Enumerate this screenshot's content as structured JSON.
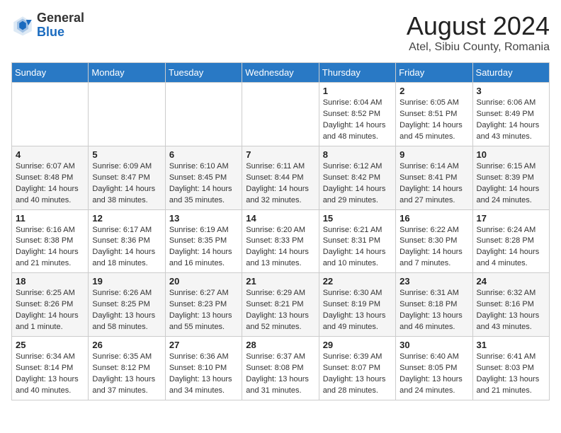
{
  "header": {
    "logo_line1": "General",
    "logo_line2": "Blue",
    "title": "August 2024",
    "subtitle": "Atel, Sibiu County, Romania"
  },
  "weekdays": [
    "Sunday",
    "Monday",
    "Tuesday",
    "Wednesday",
    "Thursday",
    "Friday",
    "Saturday"
  ],
  "weeks": [
    [
      {
        "day": "",
        "info": ""
      },
      {
        "day": "",
        "info": ""
      },
      {
        "day": "",
        "info": ""
      },
      {
        "day": "",
        "info": ""
      },
      {
        "day": "1",
        "info": "Sunrise: 6:04 AM\nSunset: 8:52 PM\nDaylight: 14 hours and 48 minutes."
      },
      {
        "day": "2",
        "info": "Sunrise: 6:05 AM\nSunset: 8:51 PM\nDaylight: 14 hours and 45 minutes."
      },
      {
        "day": "3",
        "info": "Sunrise: 6:06 AM\nSunset: 8:49 PM\nDaylight: 14 hours and 43 minutes."
      }
    ],
    [
      {
        "day": "4",
        "info": "Sunrise: 6:07 AM\nSunset: 8:48 PM\nDaylight: 14 hours and 40 minutes."
      },
      {
        "day": "5",
        "info": "Sunrise: 6:09 AM\nSunset: 8:47 PM\nDaylight: 14 hours and 38 minutes."
      },
      {
        "day": "6",
        "info": "Sunrise: 6:10 AM\nSunset: 8:45 PM\nDaylight: 14 hours and 35 minutes."
      },
      {
        "day": "7",
        "info": "Sunrise: 6:11 AM\nSunset: 8:44 PM\nDaylight: 14 hours and 32 minutes."
      },
      {
        "day": "8",
        "info": "Sunrise: 6:12 AM\nSunset: 8:42 PM\nDaylight: 14 hours and 29 minutes."
      },
      {
        "day": "9",
        "info": "Sunrise: 6:14 AM\nSunset: 8:41 PM\nDaylight: 14 hours and 27 minutes."
      },
      {
        "day": "10",
        "info": "Sunrise: 6:15 AM\nSunset: 8:39 PM\nDaylight: 14 hours and 24 minutes."
      }
    ],
    [
      {
        "day": "11",
        "info": "Sunrise: 6:16 AM\nSunset: 8:38 PM\nDaylight: 14 hours and 21 minutes."
      },
      {
        "day": "12",
        "info": "Sunrise: 6:17 AM\nSunset: 8:36 PM\nDaylight: 14 hours and 18 minutes."
      },
      {
        "day": "13",
        "info": "Sunrise: 6:19 AM\nSunset: 8:35 PM\nDaylight: 14 hours and 16 minutes."
      },
      {
        "day": "14",
        "info": "Sunrise: 6:20 AM\nSunset: 8:33 PM\nDaylight: 14 hours and 13 minutes."
      },
      {
        "day": "15",
        "info": "Sunrise: 6:21 AM\nSunset: 8:31 PM\nDaylight: 14 hours and 10 minutes."
      },
      {
        "day": "16",
        "info": "Sunrise: 6:22 AM\nSunset: 8:30 PM\nDaylight: 14 hours and 7 minutes."
      },
      {
        "day": "17",
        "info": "Sunrise: 6:24 AM\nSunset: 8:28 PM\nDaylight: 14 hours and 4 minutes."
      }
    ],
    [
      {
        "day": "18",
        "info": "Sunrise: 6:25 AM\nSunset: 8:26 PM\nDaylight: 14 hours and 1 minute."
      },
      {
        "day": "19",
        "info": "Sunrise: 6:26 AM\nSunset: 8:25 PM\nDaylight: 13 hours and 58 minutes."
      },
      {
        "day": "20",
        "info": "Sunrise: 6:27 AM\nSunset: 8:23 PM\nDaylight: 13 hours and 55 minutes."
      },
      {
        "day": "21",
        "info": "Sunrise: 6:29 AM\nSunset: 8:21 PM\nDaylight: 13 hours and 52 minutes."
      },
      {
        "day": "22",
        "info": "Sunrise: 6:30 AM\nSunset: 8:19 PM\nDaylight: 13 hours and 49 minutes."
      },
      {
        "day": "23",
        "info": "Sunrise: 6:31 AM\nSunset: 8:18 PM\nDaylight: 13 hours and 46 minutes."
      },
      {
        "day": "24",
        "info": "Sunrise: 6:32 AM\nSunset: 8:16 PM\nDaylight: 13 hours and 43 minutes."
      }
    ],
    [
      {
        "day": "25",
        "info": "Sunrise: 6:34 AM\nSunset: 8:14 PM\nDaylight: 13 hours and 40 minutes."
      },
      {
        "day": "26",
        "info": "Sunrise: 6:35 AM\nSunset: 8:12 PM\nDaylight: 13 hours and 37 minutes."
      },
      {
        "day": "27",
        "info": "Sunrise: 6:36 AM\nSunset: 8:10 PM\nDaylight: 13 hours and 34 minutes."
      },
      {
        "day": "28",
        "info": "Sunrise: 6:37 AM\nSunset: 8:08 PM\nDaylight: 13 hours and 31 minutes."
      },
      {
        "day": "29",
        "info": "Sunrise: 6:39 AM\nSunset: 8:07 PM\nDaylight: 13 hours and 28 minutes."
      },
      {
        "day": "30",
        "info": "Sunrise: 6:40 AM\nSunset: 8:05 PM\nDaylight: 13 hours and 24 minutes."
      },
      {
        "day": "31",
        "info": "Sunrise: 6:41 AM\nSunset: 8:03 PM\nDaylight: 13 hours and 21 minutes."
      }
    ]
  ]
}
